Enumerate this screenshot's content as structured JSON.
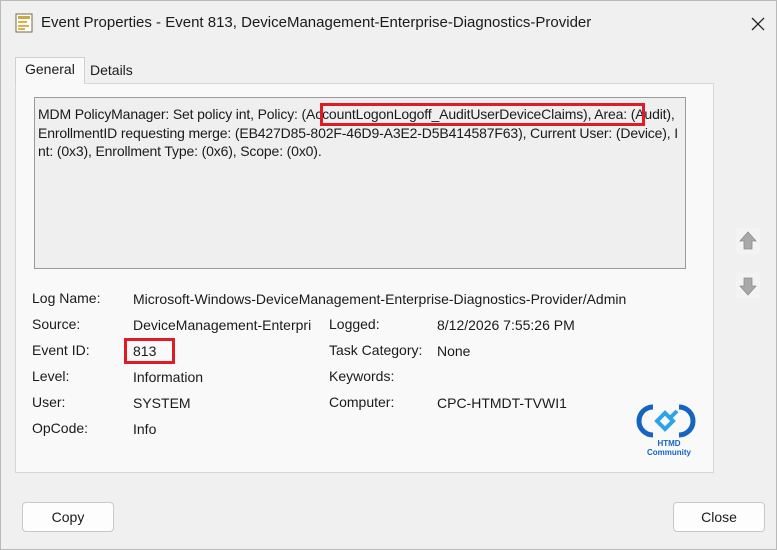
{
  "window": {
    "title": "Event Properties - Event 813, DeviceManagement-Enterprise-Diagnostics-Provider"
  },
  "tabs": [
    {
      "label": "General",
      "selected": true
    },
    {
      "label": "Details",
      "selected": false
    }
  ],
  "message": {
    "before": "MDM PolicyManager: Set policy int, Policy: ",
    "policy": "(AccountLogonLogoff_AuditUserDeviceClaims)",
    "after": ", Area: (Audit), EnrollmentID requesting merge: (EB427D85-802F-46D9-A3E2-D5B414587F63), Current User: (Device), Int: (0x3), Enrollment Type: (0x6), Scope: (0x0)."
  },
  "fields": {
    "log_name": {
      "label": "Log Name:",
      "value": "Microsoft-Windows-DeviceManagement-Enterprise-Diagnostics-Provider/Admin"
    },
    "source": {
      "label": "Source:",
      "value": "DeviceManagement-Enterpri"
    },
    "logged": {
      "label": "Logged:",
      "value": "8/12/2026 7:55:26 PM"
    },
    "event_id": {
      "label": "Event ID:",
      "value": "813"
    },
    "task_category": {
      "label": "Task Category:",
      "value": "None"
    },
    "level": {
      "label": "Level:",
      "value": "Information"
    },
    "keywords": {
      "label": "Keywords:",
      "value": ""
    },
    "user": {
      "label": "User:",
      "value": "SYSTEM"
    },
    "computer": {
      "label": "Computer:",
      "value": "CPC-HTMDT-TVWI1"
    },
    "opcode": {
      "label": "OpCode:",
      "value": "Info"
    }
  },
  "watermark": {
    "text": "HTMD Community",
    "color": "#1565c0"
  },
  "buttons": {
    "copy": "Copy",
    "close": "Close"
  },
  "icons": {
    "app": "event-viewer-icon",
    "close": "close-icon",
    "up": "arrow-up-icon",
    "down": "arrow-down-icon"
  },
  "colors": {
    "highlight": "#e01b24",
    "background": "#f0f0f0"
  }
}
